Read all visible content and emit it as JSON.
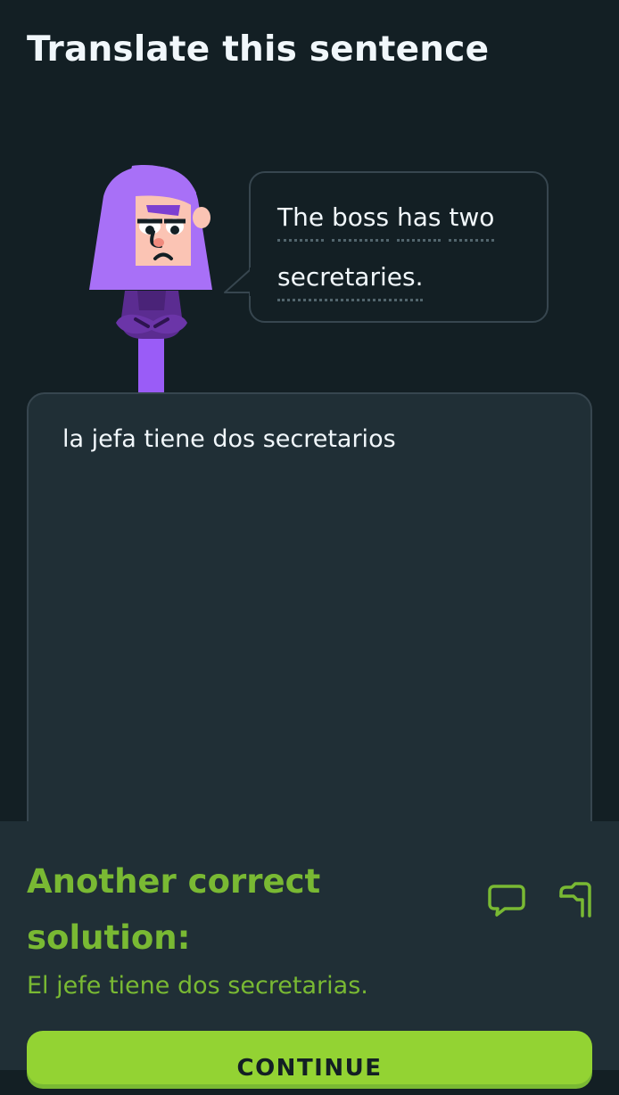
{
  "header": {
    "title": "Translate this sentence"
  },
  "prompt": {
    "words_line1": [
      "The",
      "boss",
      "has",
      "two"
    ],
    "words_line2": [
      "secretaries."
    ]
  },
  "answer": {
    "text": "la jefa tiene dos secretarios"
  },
  "feedback": {
    "heading": "Another correct solution:",
    "solution": "El jefe tiene dos secretarias.",
    "comment_icon": "speech-bubble-icon",
    "report_icon": "flag-icon",
    "continue_label": "CONTINUE"
  },
  "colors": {
    "background": "#131f24",
    "panel": "#202f36",
    "border": "#37464f",
    "text": "#f1f7fb",
    "success_text": "#79b933",
    "success_button": "#93d333",
    "character_purple": "#8f4cf2"
  }
}
